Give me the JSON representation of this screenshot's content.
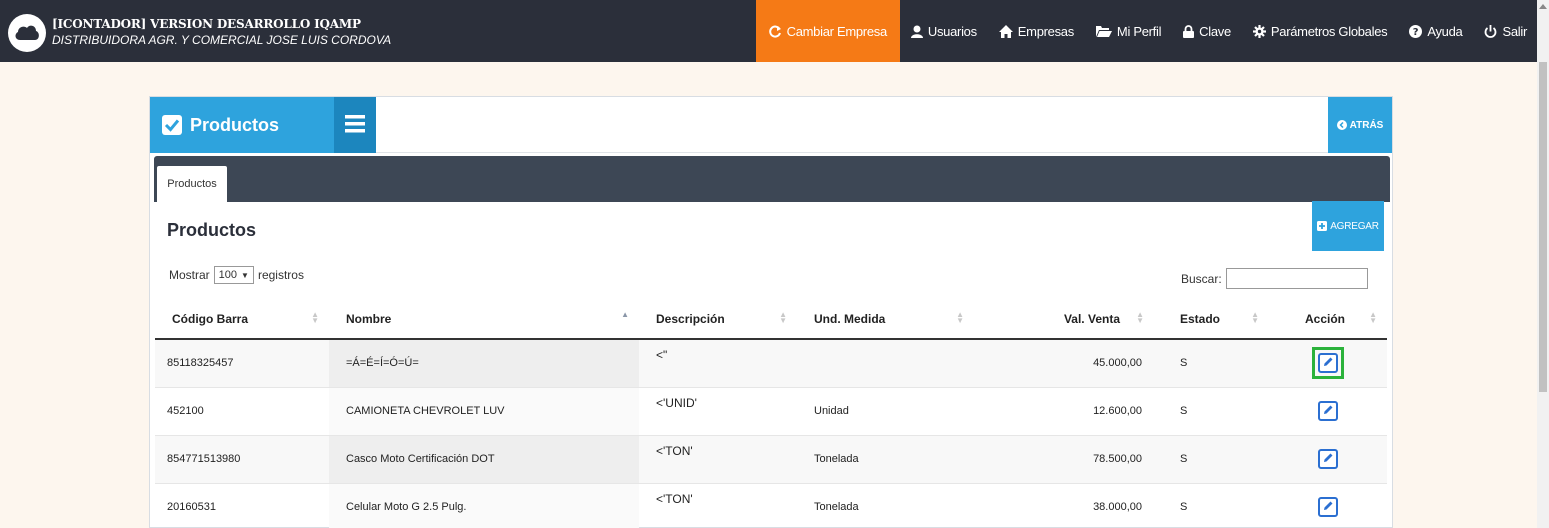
{
  "app": {
    "title": "[ICONTADOR] VERSION DESARROLLO IQAMP",
    "company": "DISTRIBUIDORA AGR. Y COMERCIAL JOSE LUIS CORDOVA"
  },
  "nav": {
    "cambiar": "Cambiar Empresa",
    "usuarios": "Usuarios",
    "empresas": "Empresas",
    "perfil": "Mi Perfil",
    "clave": "Clave",
    "parametros": "Parámetros Globales",
    "ayuda": "Ayuda",
    "salir": "Salir"
  },
  "panel": {
    "title": "Productos",
    "back": "ATRÁS",
    "tab": "Productos",
    "section_title": "Productos",
    "add": "AGREGAR"
  },
  "filters": {
    "show_prefix": "Mostrar",
    "page_size": "100",
    "show_suffix": "registros",
    "search_label": "Buscar:",
    "search_value": ""
  },
  "table": {
    "headers": {
      "codigo": "Código Barra",
      "nombre": "Nombre",
      "descripcion": "Descripción",
      "unidad": "Und. Medida",
      "valor": "Val. Venta",
      "estado": "Estado",
      "accion": "Acción"
    },
    "rows": [
      {
        "codigo": "85118325457",
        "nombre": "=Á=É=Í=Ó=Ú=",
        "descripcion": "<\"",
        "unidad": "",
        "valor": "45.000,00",
        "estado": "S"
      },
      {
        "codigo": "452100",
        "nombre": "CAMIONETA CHEVROLET LUV",
        "descripcion": "<'UNID'",
        "unidad": "Unidad",
        "valor": "12.600,00",
        "estado": "S"
      },
      {
        "codigo": "854771513980",
        "nombre": "Casco Moto Certificación DOT",
        "descripcion": "<'TON'",
        "unidad": "Tonelada",
        "valor": "78.500,00",
        "estado": "S"
      },
      {
        "codigo": "20160531",
        "nombre": "Celular Moto G 2.5 Pulg.",
        "descripcion": "<'TON'",
        "unidad": "Tonelada",
        "valor": "38.000,00",
        "estado": "S"
      }
    ]
  },
  "colors": {
    "topbar": "#2b2f3a",
    "active_nav": "#f57a16",
    "primary": "#2ea3dd",
    "tabbar": "#3d4755",
    "highlight": "#2bb23b"
  }
}
